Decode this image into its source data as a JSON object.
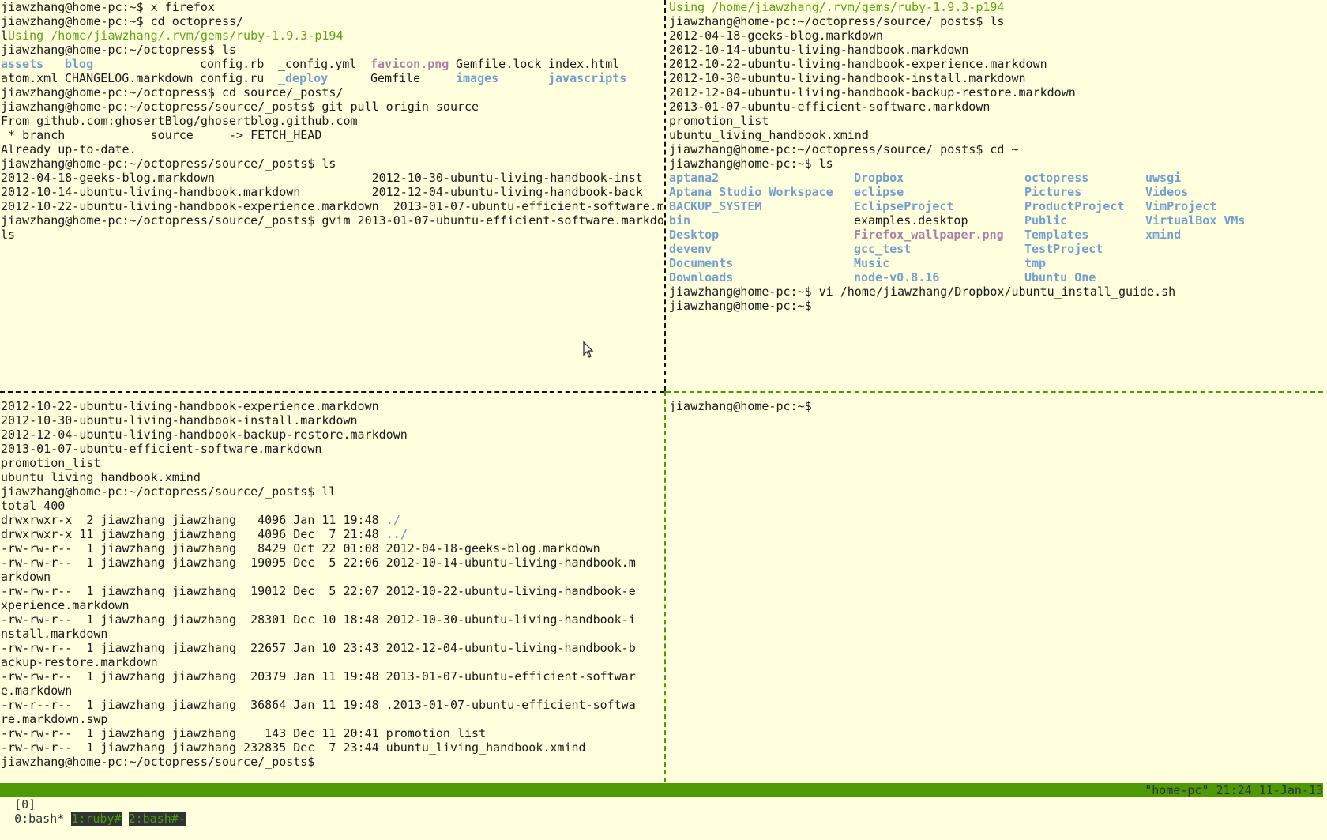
{
  "terminal": {
    "background": "#ffffdd",
    "colors": {
      "directory": "#729fcf",
      "image_file": "#ad7fa8",
      "ruby_notice": "#5fa31a",
      "status_bar": "#4e9a06"
    }
  },
  "pane_top_left": {
    "lines": [
      "jiawzhang@home-pc:~$ x firefox",
      "jiawzhang@home-pc:~$ cd octopress/",
      "lUsing /home/jiawzhang/.rvm/gems/ruby-1.9.3-p194",
      "jiawzhang@home-pc:~/octopress$ ls"
    ],
    "ls_rows": [
      [
        {
          "t": "assets",
          "c": "dir",
          "w": 9
        },
        {
          "t": "blog",
          "c": "dir",
          "w": 19
        },
        {
          "t": "config.rb",
          "c": "plain",
          "w": 11
        },
        {
          "t": "_config.yml",
          "c": "plain",
          "w": 13
        },
        {
          "t": "favicon.png",
          "c": "img",
          "w": 12
        },
        {
          "t": "Gemfile.lock",
          "c": "plain",
          "w": 13
        },
        {
          "t": "index.html",
          "c": "plain",
          "w": 10
        }
      ],
      [
        {
          "t": "atom.xml",
          "c": "plain",
          "w": 9
        },
        {
          "t": "CHANGELOG.markdown",
          "c": "plain",
          "w": 19
        },
        {
          "t": "config.ru",
          "c": "plain",
          "w": 11
        },
        {
          "t": "_deploy",
          "c": "dir",
          "w": 13
        },
        {
          "t": "Gemfile",
          "c": "plain",
          "w": 12
        },
        {
          "t": "images",
          "c": "dir",
          "w": 13
        },
        {
          "t": "javascripts",
          "c": "dir",
          "w": 11
        }
      ]
    ],
    "lines_after": [
      "jiawzhang@home-pc:~/octopress$ cd source/_posts/",
      "jiawzhang@home-pc:~/octopress/source/_posts$ git pull origin source",
      "From github.com:ghosertBlog/ghosertblog.github.com",
      " * branch            source     -> FETCH_HEAD",
      "Already up-to-date.",
      "jiawzhang@home-pc:~/octopress/source/_posts$ ls",
      "2012-04-18-geeks-blog.markdown                      2012-10-30-ubuntu-living-handbook-inst",
      "2012-10-14-ubuntu-living-handbook.markdown          2012-12-04-ubuntu-living-handbook-back",
      "2012-10-22-ubuntu-living-handbook-experience.markdown  2013-01-07-ubuntu-efficient-software.m",
      "jiawzhang@home-pc:~/octopress/source/_posts$ gvim 2013-01-07-ubuntu-efficient-software.markdo",
      "ls"
    ]
  },
  "pane_top_right": {
    "ruby_notice": "Using /home/jiawzhang/.rvm/gems/ruby-1.9.3-p194",
    "lines": [
      "jiawzhang@home-pc:~/octopress/source/_posts$ ls",
      "2012-04-18-geeks-blog.markdown",
      "2012-10-14-ubuntu-living-handbook.markdown",
      "2012-10-22-ubuntu-living-handbook-experience.markdown",
      "2012-10-30-ubuntu-living-handbook-install.markdown",
      "2012-12-04-ubuntu-living-handbook-backup-restore.markdown",
      "2013-01-07-ubuntu-efficient-software.markdown",
      "promotion_list",
      "ubuntu_living_handbook.xmind",
      "jiawzhang@home-pc:~/octopress/source/_posts$ cd ~",
      "jiawzhang@home-pc:~$ ls"
    ],
    "home_ls_rows": [
      [
        {
          "t": "aptana2",
          "c": "dir"
        },
        {
          "t": "Dropbox",
          "c": "dir"
        },
        {
          "t": "octopress",
          "c": "dir"
        },
        {
          "t": "uwsgi",
          "c": "dir"
        }
      ],
      [
        {
          "t": "Aptana Studio Workspace",
          "c": "dir"
        },
        {
          "t": "eclipse",
          "c": "dir"
        },
        {
          "t": "Pictures",
          "c": "dir"
        },
        {
          "t": "Videos",
          "c": "dir"
        }
      ],
      [
        {
          "t": "BACKUP_SYSTEM",
          "c": "dir"
        },
        {
          "t": "EclipseProject",
          "c": "dir"
        },
        {
          "t": "ProductProject",
          "c": "dir"
        },
        {
          "t": "VimProject",
          "c": "dir"
        }
      ],
      [
        {
          "t": "bin",
          "c": "dir"
        },
        {
          "t": "examples.desktop",
          "c": "plain"
        },
        {
          "t": "Public",
          "c": "dir"
        },
        {
          "t": "VirtualBox VMs",
          "c": "dir"
        }
      ],
      [
        {
          "t": "Desktop",
          "c": "dir"
        },
        {
          "t": "Firefox_wallpaper.png",
          "c": "img"
        },
        {
          "t": "Templates",
          "c": "dir"
        },
        {
          "t": "xmind",
          "c": "dir"
        }
      ],
      [
        {
          "t": "devenv",
          "c": "dir"
        },
        {
          "t": "gcc_test",
          "c": "dir"
        },
        {
          "t": "TestProject",
          "c": "dir"
        },
        {
          "t": "",
          "c": "plain"
        }
      ],
      [
        {
          "t": "Documents",
          "c": "dir"
        },
        {
          "t": "Music",
          "c": "dir"
        },
        {
          "t": "tmp",
          "c": "dir"
        },
        {
          "t": "",
          "c": "plain"
        }
      ],
      [
        {
          "t": "Downloads",
          "c": "dir"
        },
        {
          "t": "node-v0.8.16",
          "c": "dir"
        },
        {
          "t": "Ubuntu One",
          "c": "dir"
        },
        {
          "t": "",
          "c": "plain"
        }
      ]
    ],
    "lines_after": [
      "jiawzhang@home-pc:~$ vi /home/jiawzhang/Dropbox/ubuntu_install_guide.sh",
      "jiawzhang@home-pc:~$"
    ]
  },
  "pane_bottom_left": {
    "lines": [
      "2012-10-22-ubuntu-living-handbook-experience.markdown",
      "2012-10-30-ubuntu-living-handbook-install.markdown",
      "2012-12-04-ubuntu-living-handbook-backup-restore.markdown",
      "2013-01-07-ubuntu-efficient-software.markdown",
      "promotion_list",
      "ubuntu_living_handbook.xmind",
      "jiawzhang@home-pc:~/octopress/source/_posts$ ll",
      "total 400"
    ],
    "ll_rows": [
      {
        "prefix": "drwxrwxr-x  2 jiawzhang jiawzhang   4096 Jan 11 19:48 ",
        "name": "./",
        "dots": true
      },
      {
        "prefix": "drwxrwxr-x 11 jiawzhang jiawzhang   4096 Dec  7 21:48 ",
        "name": "../",
        "dots": true
      },
      {
        "prefix": "-rw-rw-r--  1 jiawzhang jiawzhang   8429 Oct 22 01:08 ",
        "name": "2012-04-18-geeks-blog.markdown"
      },
      {
        "prefix": "-rw-rw-r--  1 jiawzhang jiawzhang  19095 Dec  5 22:06 ",
        "name": "2012-10-14-ubuntu-living-handbook.m",
        "wrap": "arkdown"
      },
      {
        "prefix": "-rw-rw-r--  1 jiawzhang jiawzhang  19012 Dec  5 22:07 ",
        "name": "2012-10-22-ubuntu-living-handbook-e",
        "wrap": "xperience.markdown"
      },
      {
        "prefix": "-rw-rw-r--  1 jiawzhang jiawzhang  28301 Dec 10 18:48 ",
        "name": "2012-10-30-ubuntu-living-handbook-i",
        "wrap": "nstall.markdown"
      },
      {
        "prefix": "-rw-rw-r--  1 jiawzhang jiawzhang  22657 Jan 10 23:43 ",
        "name": "2012-12-04-ubuntu-living-handbook-b",
        "wrap": "ackup-restore.markdown"
      },
      {
        "prefix": "-rw-rw-r--  1 jiawzhang jiawzhang  20379 Jan 11 19:48 ",
        "name": "2013-01-07-ubuntu-efficient-softwar",
        "wrap": "e.markdown"
      },
      {
        "prefix": "-rw-r--r--  1 jiawzhang jiawzhang  36864 Jan 11 19:48 ",
        "name": ".2013-01-07-ubuntu-efficient-softwa",
        "wrap": "re.markdown.swp"
      },
      {
        "prefix": "-rw-rw-r--  1 jiawzhang jiawzhang    143 Dec 11 20:41 ",
        "name": "promotion_list"
      },
      {
        "prefix": "-rw-rw-r--  1 jiawzhang jiawzhang 232835 Dec  7 23:44 ",
        "name": "ubuntu_living_handbook.xmind"
      }
    ],
    "prompt": "jiawzhang@home-pc:~/octopress/source/_posts$"
  },
  "pane_bottom_right": {
    "prompt": "jiawzhang@home-pc:~$"
  },
  "status_bar": {
    "session": "[0]",
    "windows": [
      {
        "label": "0:bash*",
        "active": true
      },
      {
        "label": "1:ruby#",
        "active": false
      },
      {
        "label": "2:bash#-",
        "active": false
      }
    ],
    "host": "\"home-pc\"",
    "time": "21:24",
    "date": "11-Jan-13"
  }
}
